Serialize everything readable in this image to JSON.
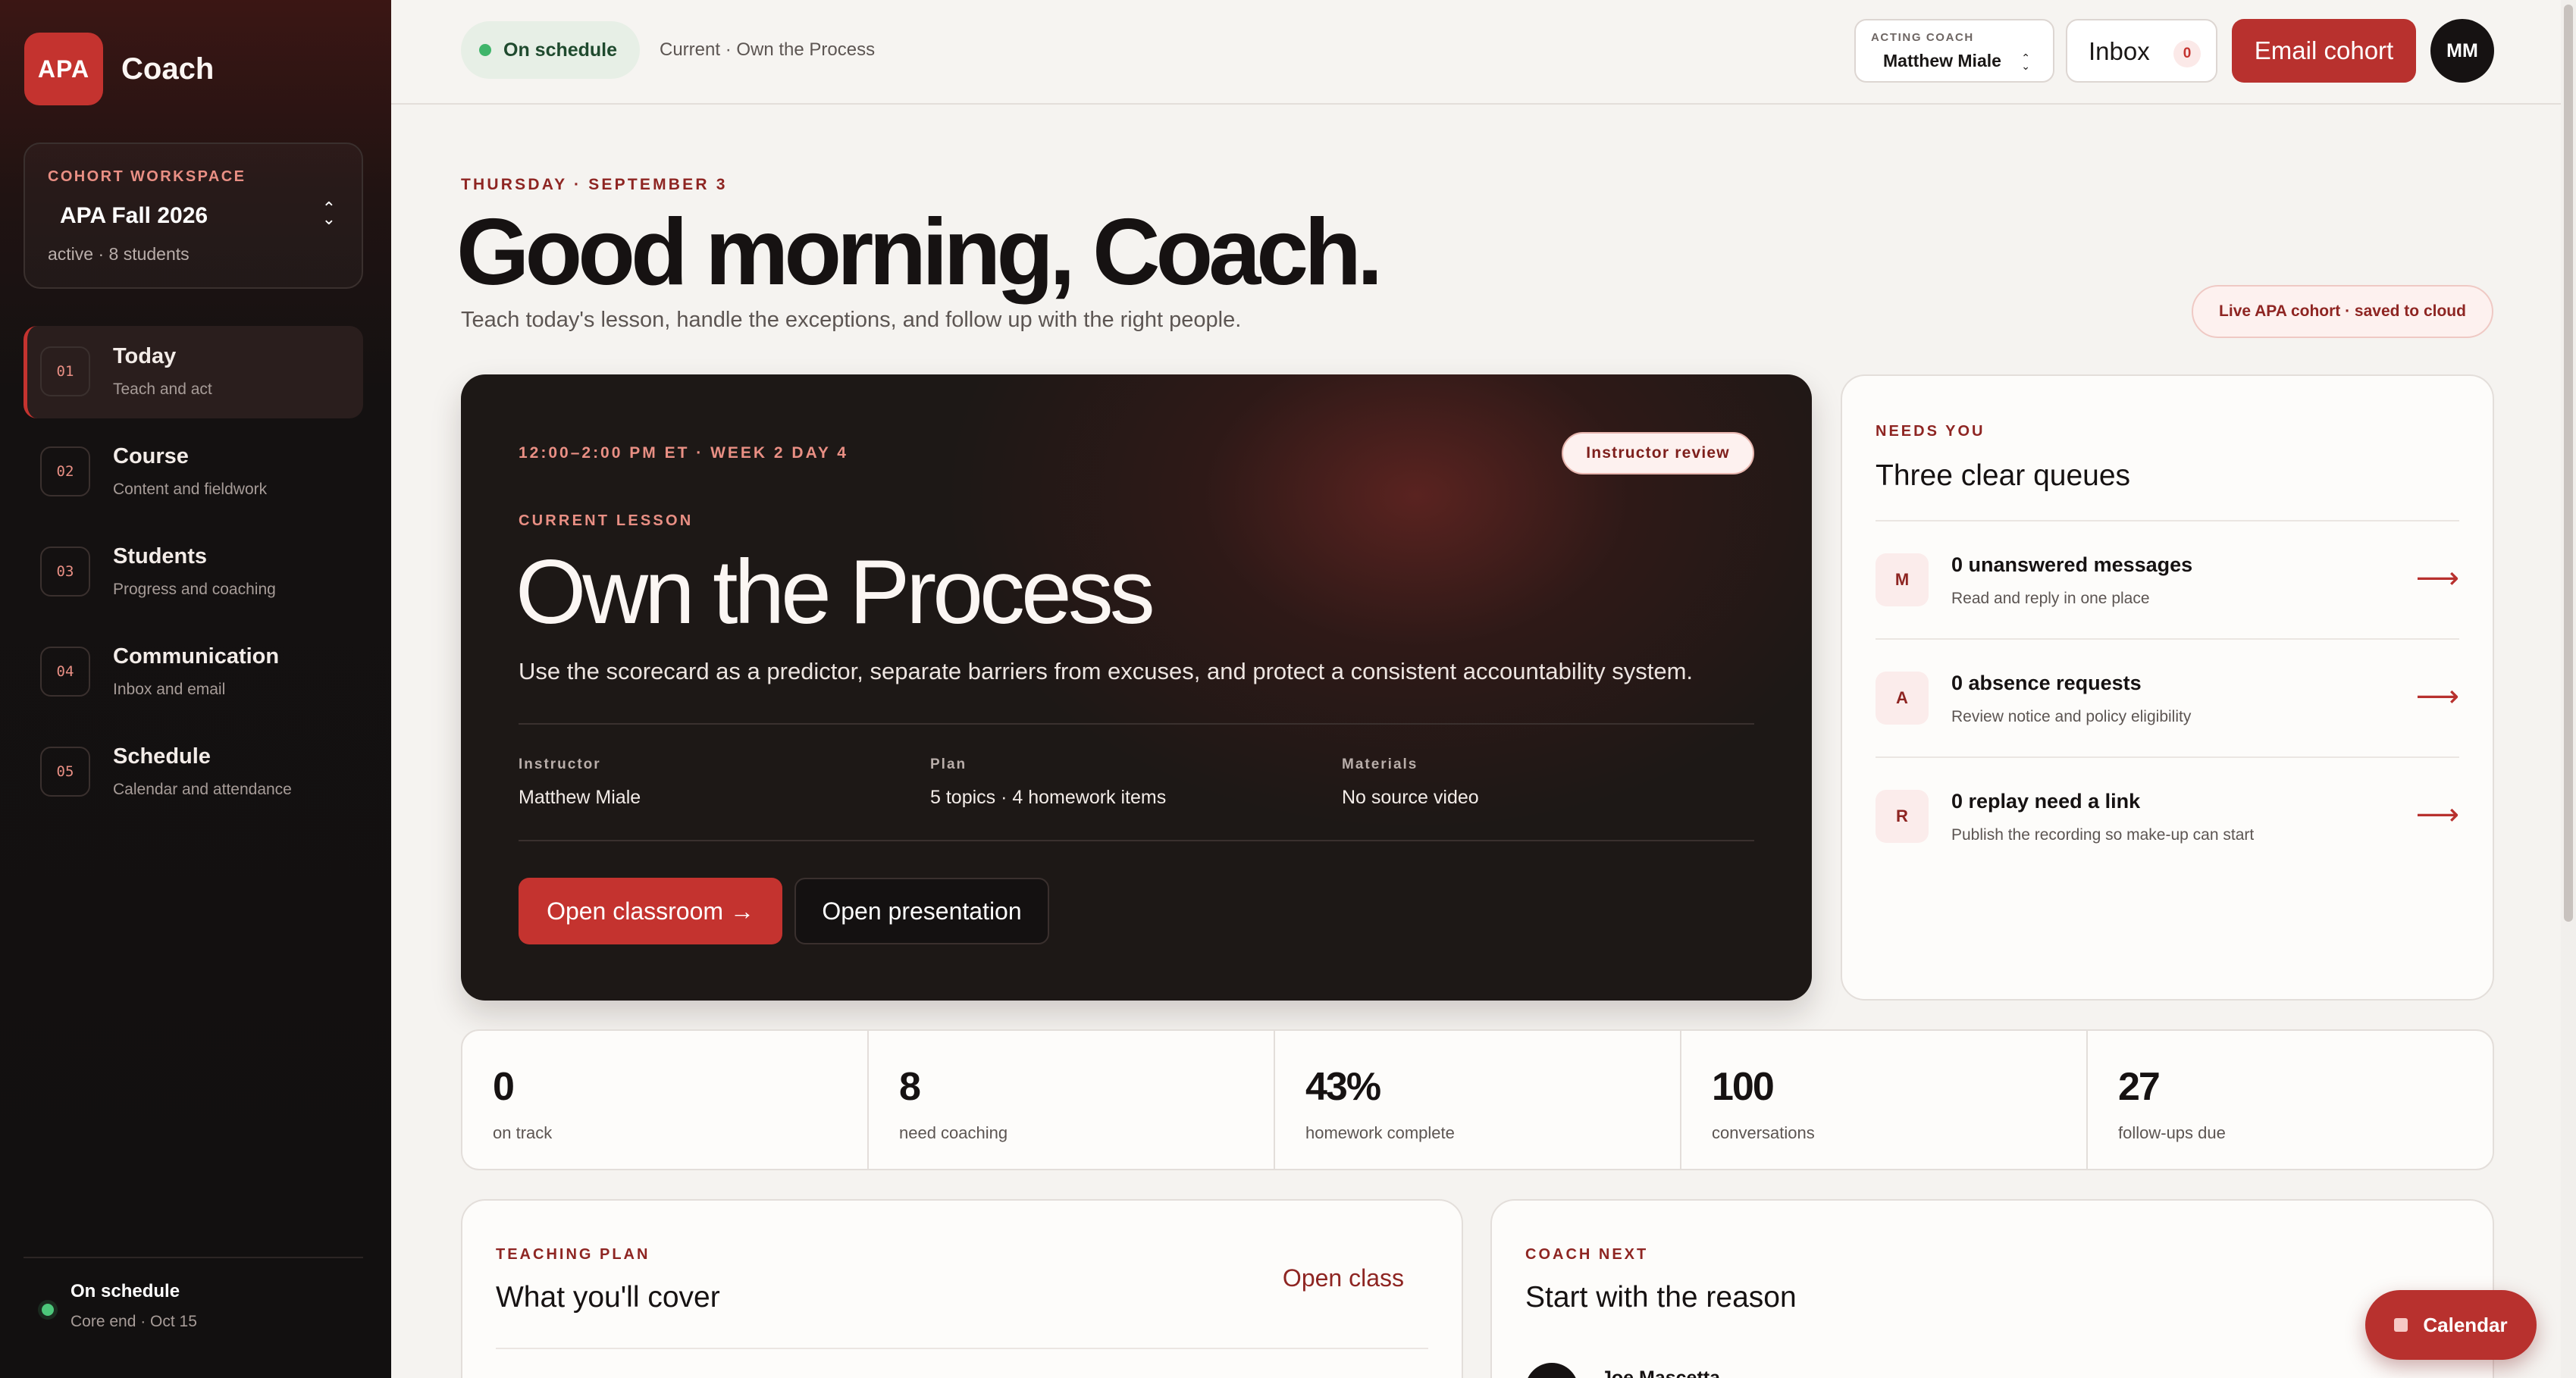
{
  "brand": {
    "logo": "APA",
    "name": "Coach"
  },
  "workspace": {
    "label": "COHORT WORKSPACE",
    "name": "APA Fall 2026",
    "meta": "active · 8 students"
  },
  "nav": [
    {
      "num": "01",
      "title": "Today",
      "sub": "Teach and act",
      "active": true
    },
    {
      "num": "02",
      "title": "Course",
      "sub": "Content and fieldwork"
    },
    {
      "num": "03",
      "title": "Students",
      "sub": "Progress and coaching"
    },
    {
      "num": "04",
      "title": "Communication",
      "sub": "Inbox and email"
    },
    {
      "num": "05",
      "title": "Schedule",
      "sub": "Calendar and attendance"
    }
  ],
  "sidebar_footer": {
    "title": "On schedule",
    "sub": "Core end · Oct 15"
  },
  "topbar": {
    "status": "On schedule",
    "crumb": "Current · Own the Process",
    "acting_label": "ACTING COACH",
    "acting_name": "Matthew Miale",
    "inbox_label": "Inbox",
    "inbox_count": "0",
    "email_button": "Email cohort",
    "avatar": "MM"
  },
  "hero": {
    "date": "THURSDAY · SEPTEMBER 3",
    "greeting": "Good morning, Coach.",
    "subtitle": "Teach today's lesson, handle the exceptions, and follow up with the right people.",
    "live_pill": "Live APA cohort · saved to cloud"
  },
  "lesson": {
    "time": "12:00–2:00 PM ET · WEEK 2 DAY 4",
    "review": "Instructor review",
    "label": "CURRENT LESSON",
    "title": "Own the Process",
    "description": "Use the scorecard as a predictor, separate barriers from excuses, and protect a consistent accountability system.",
    "meta": [
      {
        "label": "Instructor",
        "value": "Matthew Miale"
      },
      {
        "label": "Plan",
        "value": "5 topics · 4 homework items"
      },
      {
        "label": "Materials",
        "value": "No source video"
      }
    ],
    "open_classroom": "Open classroom →",
    "open_presentation": "Open presentation"
  },
  "queues": {
    "eyebrow": "NEEDS YOU",
    "title": "Three clear queues",
    "items": [
      {
        "badge": "M",
        "name": "0 unanswered messages",
        "sub": "Read and reply in one place",
        "arrow": "⟶"
      },
      {
        "badge": "A",
        "name": "0 absence requests",
        "sub": "Review notice and policy eligibility",
        "arrow": "⟶"
      },
      {
        "badge": "R",
        "name": "0 replay need a link",
        "sub": "Publish the recording so make-up can start",
        "arrow": "⟶"
      }
    ]
  },
  "stats": [
    {
      "value": "0",
      "label": "on track"
    },
    {
      "value": "8",
      "label": "need coaching"
    },
    {
      "value": "43%",
      "label": "homework complete"
    },
    {
      "value": "100",
      "label": "conversations"
    },
    {
      "value": "27",
      "label": "follow-ups due"
    }
  ],
  "teaching_plan": {
    "eyebrow": "TEACHING PLAN",
    "title": "What you'll cover",
    "link": "Open class"
  },
  "coach_next": {
    "eyebrow": "COACH NEXT",
    "title": "Start with the reason",
    "person": "Joe Mascetta"
  },
  "calendar_button": "Calendar"
}
